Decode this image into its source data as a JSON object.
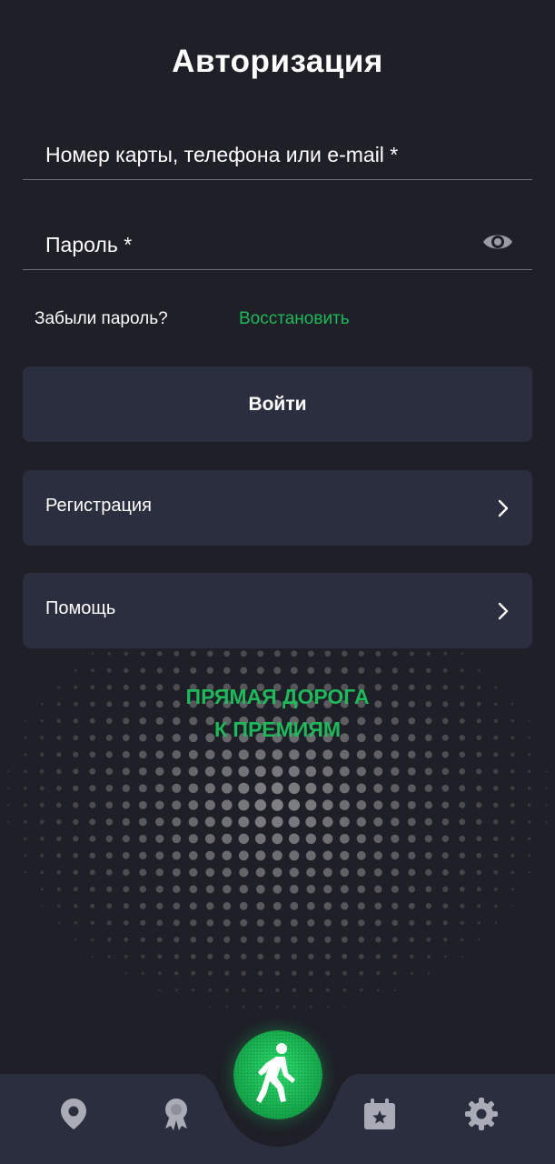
{
  "title": "Авторизация",
  "login_field": {
    "placeholder": "Номер карты, телефона или e-mail *"
  },
  "password_field": {
    "placeholder": "Пароль *",
    "toggle_icon": "eye-icon"
  },
  "forgot": {
    "text": "Забыли пароль?",
    "link": "Восстановить"
  },
  "buttons": {
    "login": "Войти",
    "register": "Регистрация",
    "help": "Помощь"
  },
  "promo": {
    "line1": "ПРЯМАЯ ДОРОГА",
    "line2": "К ПРЕМИЯМ"
  },
  "nav": {
    "items": [
      "map-pin-icon",
      "award-icon",
      "walking-icon",
      "calendar-star-icon",
      "gear-icon"
    ]
  },
  "colors": {
    "background": "#1e1f27",
    "card": "#2b2e3e",
    "accent": "#1fb85a",
    "divider": "#6c6d76",
    "nav_bar": "#2b2e3e",
    "icon": "#a9abb6"
  }
}
